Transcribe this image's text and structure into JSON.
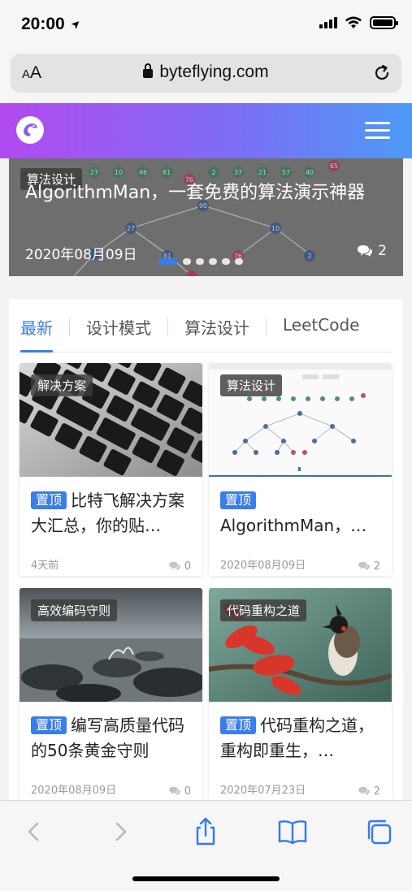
{
  "status_bar": {
    "time": "20:00",
    "location_glyph": "➤"
  },
  "browser": {
    "text_size_label_small": "A",
    "text_size_label_large": "A",
    "url": "byteflying.com"
  },
  "banner": {
    "category": "算法设计",
    "title": "AlgorithmMan，一套免费的算法演示神器",
    "date": "2020年08月09日",
    "comments": "2",
    "node_labels": [
      "27",
      "10",
      "46",
      "81",
      "76",
      "2",
      "37",
      "21",
      "57",
      "40",
      "65",
      "90",
      "27",
      "10",
      "2",
      "81",
      "76"
    ]
  },
  "tabs": [
    {
      "label": "最新",
      "active": true
    },
    {
      "label": "设计模式",
      "active": false
    },
    {
      "label": "算法设计",
      "active": false
    },
    {
      "label": "LeetCode",
      "active": false
    }
  ],
  "posts": [
    {
      "category": "解决方案",
      "pin": "置顶",
      "title": "比特飞解决方案大汇总，你的贴…",
      "date": "4天前",
      "comments": "0",
      "image": "keyboard"
    },
    {
      "category": "算法设计",
      "pin": "置顶",
      "title": "AlgorithmMan，…",
      "date": "2020年08月09日",
      "comments": "2",
      "image": "algorithm-app"
    },
    {
      "category": "高效编码守则",
      "pin": "置顶",
      "title": "编写高质量代码的50条黄金守则",
      "date": "2020年08月09日",
      "comments": "0",
      "image": "rocks-water"
    },
    {
      "category": "代码重构之道",
      "pin": "置顶",
      "title": "代码重构之道，重构即重生，…",
      "date": "2020年07月23日",
      "comments": "2",
      "image": "bird-flower"
    }
  ],
  "colors": {
    "accent": "#3b7de9",
    "header_start": "#b14af0",
    "header_end": "#4d9af5"
  }
}
